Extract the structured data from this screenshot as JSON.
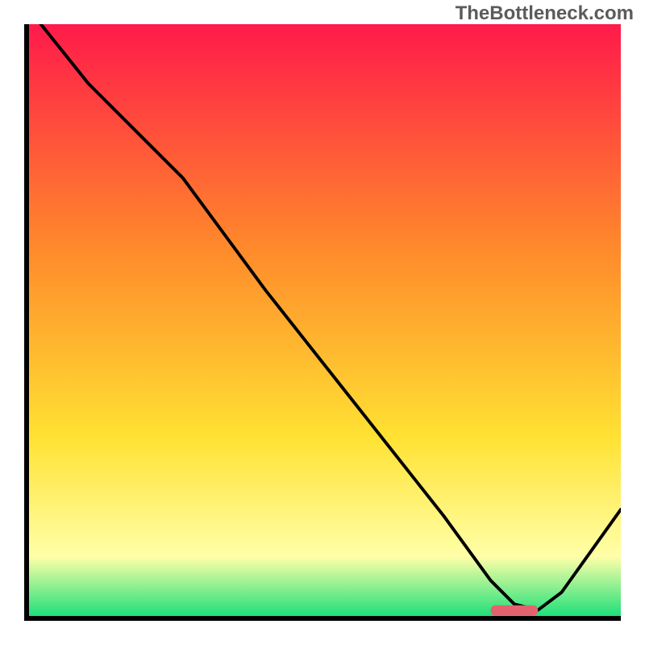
{
  "watermark": "TheBottleneck.com",
  "colors": {
    "gradient_top": "#ff1a4a",
    "gradient_mid1": "#ff8a2b",
    "gradient_mid2": "#ffe233",
    "gradient_pale": "#ffffa8",
    "gradient_bottom": "#1fe07a",
    "curve": "#000000",
    "marker": "#e2636d",
    "axis": "#000000"
  },
  "chart_data": {
    "type": "line",
    "title": "",
    "xlabel": "",
    "ylabel": "",
    "xlim": [
      0,
      100
    ],
    "ylim": [
      0,
      100
    ],
    "x": [
      2,
      10,
      20,
      26,
      40,
      55,
      70,
      78,
      82,
      86,
      90,
      100
    ],
    "values": [
      100,
      90,
      80,
      74,
      55,
      36,
      17,
      6,
      2,
      1,
      4,
      18
    ],
    "note": "values are approximate percentages read from the vertical extent of the curve; chart has no numeric axis labels",
    "marker_segment": {
      "x_start": 78,
      "x_end": 86,
      "y": 1
    }
  }
}
